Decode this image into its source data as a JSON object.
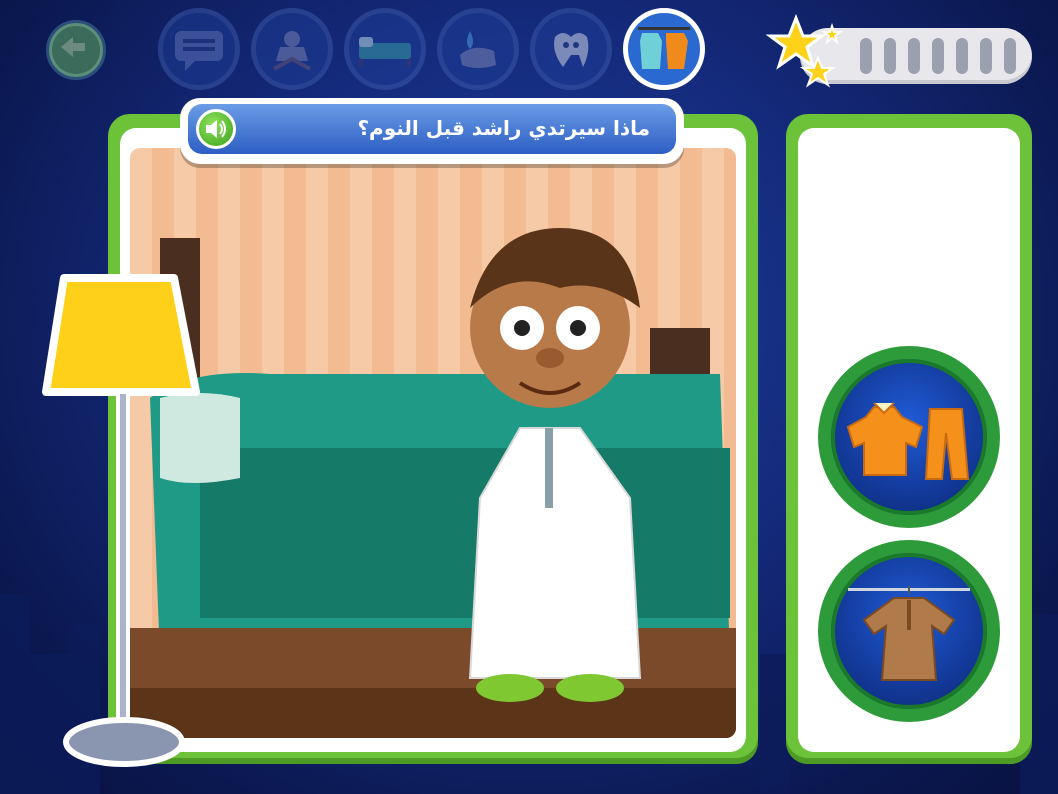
{
  "question": {
    "text": "ماذا سيرتدي راشد قبل النوم؟",
    "sound_icon": "speaker-icon"
  },
  "top_bar": {
    "back_icon": "back-arrow-icon",
    "nav_items": [
      {
        "icon": "speech-bubble-icon",
        "active": false
      },
      {
        "icon": "quran-stand-icon",
        "active": false
      },
      {
        "icon": "bed-icon",
        "active": false
      },
      {
        "icon": "washing-hands-icon",
        "active": false
      },
      {
        "icon": "tooth-brush-icon",
        "active": false
      },
      {
        "icon": "clothes-rack-icon",
        "active": true
      }
    ],
    "progress": {
      "stars_icon": "stars-icon",
      "filled": 0,
      "total": 7
    }
  },
  "scene": {
    "character": "boy-in-white-thobe",
    "props": [
      "bed",
      "floor-lamp"
    ]
  },
  "choices": [
    {
      "id": "pajamas",
      "icon": "pajamas-icon"
    },
    {
      "id": "thobe",
      "icon": "brown-thobe-on-hanger-icon"
    }
  ],
  "colors": {
    "panel_green": "#6cc33a",
    "banner_blue": "#2d5ec4",
    "choice_ring": "#2e9b3a",
    "background": "#14297a"
  }
}
